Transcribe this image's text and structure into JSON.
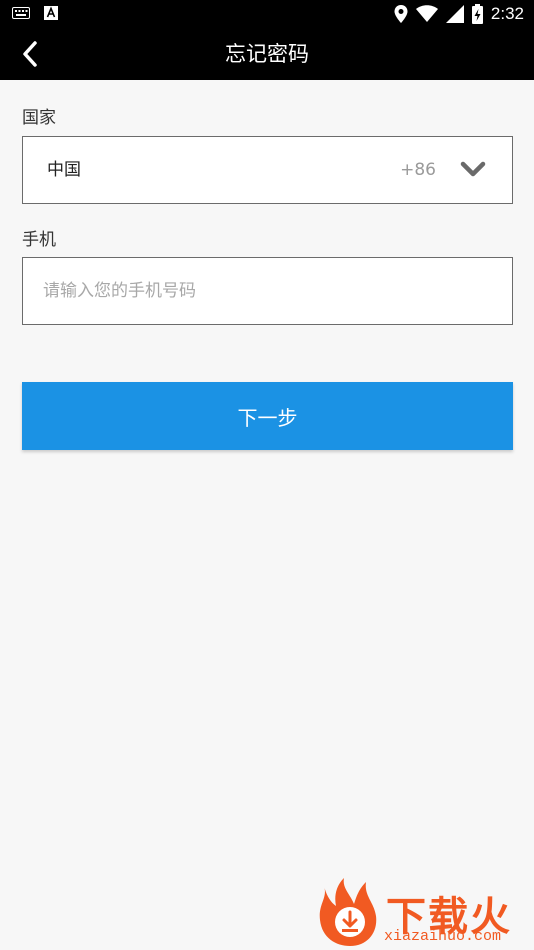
{
  "status_bar": {
    "time": "2:32",
    "icons": [
      "keyboard-icon",
      "a-notification-icon",
      "location-icon",
      "wifi-icon",
      "signal-icon",
      "battery-charging-icon"
    ]
  },
  "header": {
    "title": "忘记密码",
    "back_icon": "chevron-left-icon"
  },
  "form": {
    "country_label": "国家",
    "country_value": "中国",
    "country_code": "+86",
    "phone_label": "手机",
    "phone_placeholder": "请输入您的手机号码",
    "phone_value": ""
  },
  "actions": {
    "next_label": "下一步"
  },
  "watermark": {
    "title": "下载火",
    "subtitle": "xiazaihuo.com"
  },
  "colors": {
    "accent": "#1b92e4",
    "background": "#f7f7f7",
    "toolbar": "#000000",
    "watermark": "#f15a22"
  }
}
